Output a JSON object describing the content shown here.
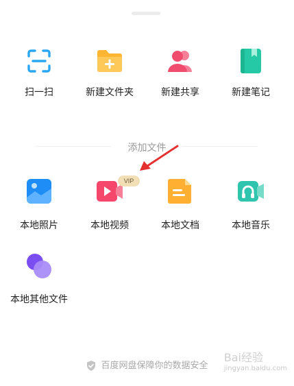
{
  "top_actions": [
    {
      "label": "扫一扫",
      "icon": "scan-icon"
    },
    {
      "label": "新建文件夹",
      "icon": "folder-add-icon"
    },
    {
      "label": "新建共享",
      "icon": "share-users-icon"
    },
    {
      "label": "新建笔记",
      "icon": "notebook-icon"
    }
  ],
  "section": {
    "title": "添加文件"
  },
  "add_files": [
    {
      "label": "本地照片",
      "icon": "photo-icon"
    },
    {
      "label": "本地视频",
      "icon": "video-icon",
      "badge": "VIP"
    },
    {
      "label": "本地文档",
      "icon": "document-icon"
    },
    {
      "label": "本地音乐",
      "icon": "music-icon"
    },
    {
      "label": "本地其他文件",
      "icon": "other-files-icon"
    }
  ],
  "footer": {
    "text": "百度网盘保障你的数据安全"
  },
  "watermark": {
    "title": "Bai经验",
    "url": "jingyan.baidu.com"
  },
  "colors": {
    "scan": "#2aa7f2",
    "folder": "#ffb534",
    "share": "#f04c6e",
    "note": "#26c9a5",
    "photo": "#1e8df5",
    "video": "#f5466c",
    "doc": "#ffb032",
    "music": "#2ec4ad",
    "other": "#8a6cf4",
    "arrow": "#e53030"
  }
}
